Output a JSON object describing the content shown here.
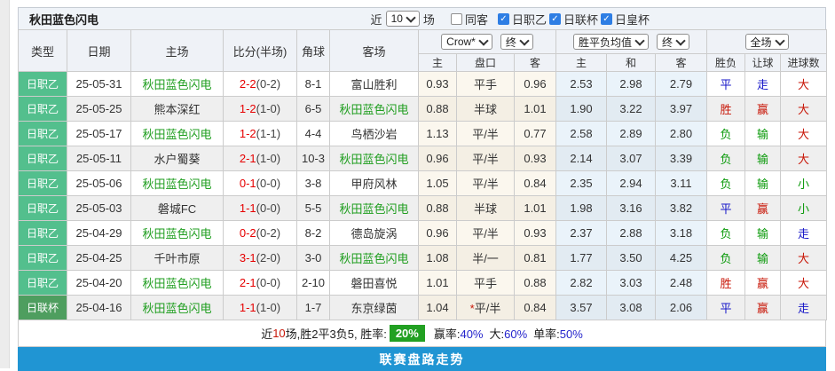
{
  "header": {
    "title": "秋田蓝色闪电",
    "near_label": "近",
    "recent_count": "10",
    "matches_label": "场",
    "checkboxes": [
      {
        "label": "同客",
        "checked": false
      },
      {
        "label": "日职乙",
        "checked": true
      },
      {
        "label": "日联杯",
        "checked": true
      },
      {
        "label": "日皇杯",
        "checked": true
      }
    ]
  },
  "table": {
    "left_headers": [
      "类型",
      "日期",
      "主场",
      "比分(半场)",
      "角球",
      "客场"
    ],
    "selects": {
      "handicap_company": "Crow*",
      "handicap_final": "终",
      "europe_company": "胜平负均值",
      "europe_final": "终",
      "scope": "全场"
    },
    "sub_headers": [
      "主",
      "盘口",
      "客",
      "主",
      "和",
      "客",
      "胜负",
      "让球",
      "进球数"
    ],
    "rows": [
      {
        "type": "日职乙",
        "type_style": "league",
        "date": "25-05-31",
        "home": "秋田蓝色闪电",
        "home_is_subject": true,
        "score": "2-2",
        "half_score": "(0-2)",
        "corners": "8-1",
        "away": "富山胜利",
        "away_is_subject": false,
        "handicap_home": "0.93",
        "handicap_line": "平手",
        "handicap_away": "0.96",
        "odds_home": "2.53",
        "odds_draw": "2.98",
        "odds_away": "2.79",
        "result_wdl": {
          "text": "平",
          "color": "blue"
        },
        "result_handicap": {
          "text": "走",
          "color": "blue"
        },
        "result_goals": {
          "text": "大",
          "color": "red"
        }
      },
      {
        "type": "日职乙",
        "type_style": "league",
        "date": "25-05-25",
        "home": "熊本深红",
        "home_is_subject": false,
        "score": "1-2",
        "half_score": "(1-0)",
        "corners": "6-5",
        "away": "秋田蓝色闪电",
        "away_is_subject": true,
        "handicap_home": "0.88",
        "handicap_line": "半球",
        "handicap_away": "1.01",
        "odds_home": "1.90",
        "odds_draw": "3.22",
        "odds_away": "3.97",
        "result_wdl": {
          "text": "胜",
          "color": "red"
        },
        "result_handicap": {
          "text": "赢",
          "color": "red"
        },
        "result_goals": {
          "text": "大",
          "color": "red"
        }
      },
      {
        "type": "日职乙",
        "type_style": "league",
        "date": "25-05-17",
        "home": "秋田蓝色闪电",
        "home_is_subject": true,
        "score": "1-2",
        "half_score": "(1-1)",
        "corners": "4-4",
        "away": "鸟栖沙岩",
        "away_is_subject": false,
        "handicap_home": "1.13",
        "handicap_line": "平/半",
        "handicap_away": "0.77",
        "odds_home": "2.58",
        "odds_draw": "2.89",
        "odds_away": "2.80",
        "result_wdl": {
          "text": "负",
          "color": "green"
        },
        "result_handicap": {
          "text": "输",
          "color": "green"
        },
        "result_goals": {
          "text": "大",
          "color": "red"
        }
      },
      {
        "type": "日职乙",
        "type_style": "league",
        "date": "25-05-11",
        "home": "水户蜀葵",
        "home_is_subject": false,
        "score": "2-1",
        "half_score": "(1-0)",
        "corners": "10-3",
        "away": "秋田蓝色闪电",
        "away_is_subject": true,
        "handicap_home": "0.96",
        "handicap_line": "平/半",
        "handicap_away": "0.93",
        "odds_home": "2.14",
        "odds_draw": "3.07",
        "odds_away": "3.39",
        "result_wdl": {
          "text": "负",
          "color": "green"
        },
        "result_handicap": {
          "text": "输",
          "color": "green"
        },
        "result_goals": {
          "text": "大",
          "color": "red"
        }
      },
      {
        "type": "日职乙",
        "type_style": "league",
        "date": "25-05-06",
        "home": "秋田蓝色闪电",
        "home_is_subject": true,
        "score": "0-1",
        "half_score": "(0-0)",
        "corners": "3-8",
        "away": "甲府风林",
        "away_is_subject": false,
        "handicap_home": "1.05",
        "handicap_line": "平/半",
        "handicap_away": "0.84",
        "odds_home": "2.35",
        "odds_draw": "2.94",
        "odds_away": "3.11",
        "result_wdl": {
          "text": "负",
          "color": "green"
        },
        "result_handicap": {
          "text": "输",
          "color": "green"
        },
        "result_goals": {
          "text": "小",
          "color": "green"
        }
      },
      {
        "type": "日职乙",
        "type_style": "league",
        "date": "25-05-03",
        "home": "磐城FC",
        "home_is_subject": false,
        "score": "1-1",
        "half_score": "(0-0)",
        "corners": "5-5",
        "away": "秋田蓝色闪电",
        "away_is_subject": true,
        "handicap_home": "0.88",
        "handicap_line": "半球",
        "handicap_away": "1.01",
        "odds_home": "1.98",
        "odds_draw": "3.16",
        "odds_away": "3.82",
        "result_wdl": {
          "text": "平",
          "color": "blue"
        },
        "result_handicap": {
          "text": "赢",
          "color": "red"
        },
        "result_goals": {
          "text": "小",
          "color": "green"
        }
      },
      {
        "type": "日职乙",
        "type_style": "league",
        "date": "25-04-29",
        "home": "秋田蓝色闪电",
        "home_is_subject": true,
        "score": "0-2",
        "half_score": "(0-2)",
        "corners": "8-2",
        "away": "德岛旋涡",
        "away_is_subject": false,
        "handicap_home": "0.96",
        "handicap_line": "平/半",
        "handicap_away": "0.93",
        "odds_home": "2.37",
        "odds_draw": "2.88",
        "odds_away": "3.18",
        "result_wdl": {
          "text": "负",
          "color": "green"
        },
        "result_handicap": {
          "text": "输",
          "color": "green"
        },
        "result_goals": {
          "text": "走",
          "color": "blue"
        }
      },
      {
        "type": "日职乙",
        "type_style": "league",
        "date": "25-04-25",
        "home": "千叶市原",
        "home_is_subject": false,
        "score": "3-1",
        "half_score": "(2-0)",
        "corners": "3-0",
        "away": "秋田蓝色闪电",
        "away_is_subject": true,
        "handicap_home": "1.08",
        "handicap_line": "半/一",
        "handicap_away": "0.81",
        "odds_home": "1.77",
        "odds_draw": "3.50",
        "odds_away": "4.25",
        "result_wdl": {
          "text": "负",
          "color": "green"
        },
        "result_handicap": {
          "text": "输",
          "color": "green"
        },
        "result_goals": {
          "text": "大",
          "color": "red"
        }
      },
      {
        "type": "日职乙",
        "type_style": "league",
        "date": "25-04-20",
        "home": "秋田蓝色闪电",
        "home_is_subject": true,
        "score": "2-1",
        "half_score": "(0-0)",
        "corners": "2-10",
        "away": "磐田喜悦",
        "away_is_subject": false,
        "handicap_home": "1.01",
        "handicap_line": "平手",
        "handicap_away": "0.88",
        "odds_home": "2.82",
        "odds_draw": "3.03",
        "odds_away": "2.48",
        "result_wdl": {
          "text": "胜",
          "color": "red"
        },
        "result_handicap": {
          "text": "赢",
          "color": "red"
        },
        "result_goals": {
          "text": "大",
          "color": "red"
        }
      },
      {
        "type": "日联杯",
        "type_style": "cup",
        "date": "25-04-16",
        "home": "秋田蓝色闪电",
        "home_is_subject": true,
        "score": "1-1",
        "half_score": "(1-0)",
        "corners": "1-7",
        "away": "东京绿茵",
        "away_is_subject": false,
        "handicap_home": "1.04",
        "handicap_line": "*平/半",
        "handicap_away": "0.84",
        "odds_home": "3.57",
        "odds_draw": "3.08",
        "odds_away": "2.06",
        "result_wdl": {
          "text": "平",
          "color": "blue"
        },
        "result_handicap": {
          "text": "赢",
          "color": "red"
        },
        "result_goals": {
          "text": "走",
          "color": "blue"
        }
      }
    ]
  },
  "summary": {
    "prefix": "近",
    "recent_count": "10",
    "record_text": "场,胜2平3负5, 胜率:",
    "win_rate_badge": "20%",
    "stats": [
      {
        "label": "赢率:",
        "value": "40%"
      },
      {
        "label": "大:",
        "value": "60%"
      },
      {
        "label": "单率:",
        "value": "50%"
      }
    ]
  },
  "footer": {
    "button_label": "联赛盘路走势"
  },
  "colors": {
    "league_badge": "#53bf8d",
    "cup_badge": "#4e9e5f",
    "subject_team_green": "#1f9e1f",
    "score_red": "#e60000",
    "badge_green": "#22a022",
    "footer_blue": "#2095d3",
    "result_red": "#c81607",
    "result_blue": "#1616c8",
    "result_green": "#0b9a0b"
  }
}
